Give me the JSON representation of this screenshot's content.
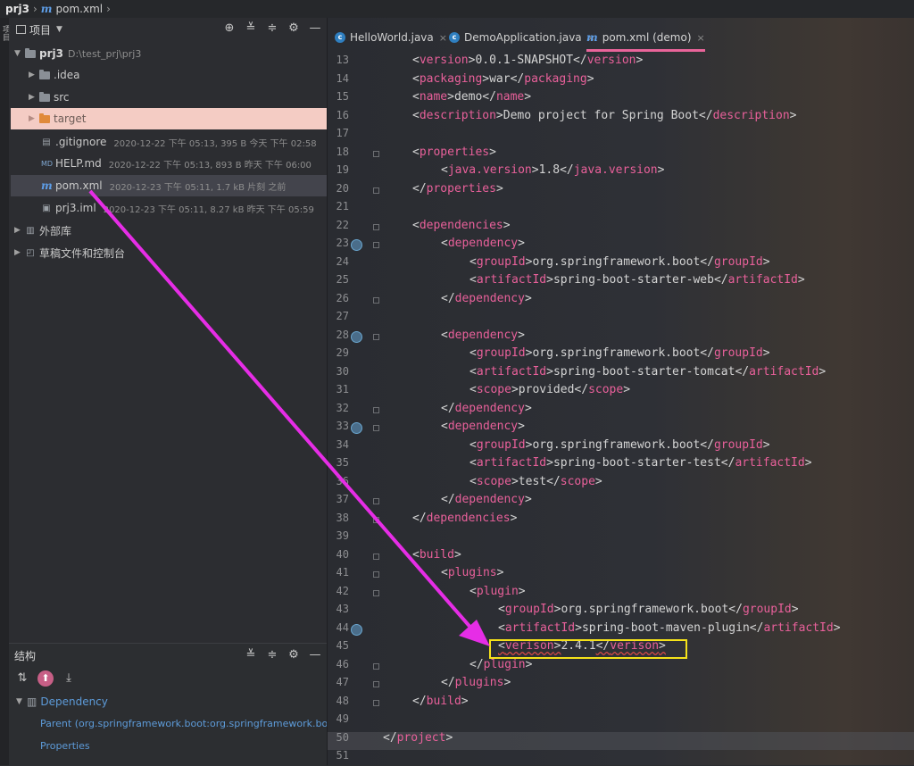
{
  "breadcrumb": {
    "project": "prj3",
    "file": "pom.xml"
  },
  "left_strip": {
    "label": "项目"
  },
  "project_panel": {
    "title": "项目",
    "items": [
      {
        "name": "prj3",
        "path": "D:\\test_prj\\prj3"
      },
      {
        "name": ".idea"
      },
      {
        "name": "src"
      },
      {
        "name": "target"
      },
      {
        "name": ".gitignore",
        "meta": "2020-12-22 下午 05:13, 395 B 今天 下午 02:58"
      },
      {
        "name": "HELP.md",
        "meta": "2020-12-22 下午 05:13, 893 B 昨天 下午 06:00"
      },
      {
        "name": "pom.xml",
        "meta": "2020-12-23 下午 05:11, 1.7 kB 片刻 之前"
      },
      {
        "name": "prj3.iml",
        "meta": "2020-12-23 下午 05:11, 8.27 kB 昨天 下午 05:59"
      },
      {
        "name": "外部库"
      },
      {
        "name": "草稿文件和控制台"
      }
    ]
  },
  "structure_panel": {
    "title": "结构",
    "items": [
      {
        "name": "Dependency"
      },
      {
        "name": "Parent (org.springframework.boot:org.springframework.boot"
      },
      {
        "name": "Properties"
      }
    ]
  },
  "tabs": [
    {
      "label": "HelloWorld.java"
    },
    {
      "label": "DemoApplication.java"
    },
    {
      "label": "pom.xml (demo)"
    }
  ],
  "editor": {
    "lines": [
      {
        "num": "13",
        "indent": 2,
        "open": "version",
        "text": "0.0.1-SNAPSHOT",
        "close": "version"
      },
      {
        "num": "14",
        "indent": 2,
        "open": "packaging",
        "text": "war",
        "close": "packaging"
      },
      {
        "num": "15",
        "indent": 2,
        "open": "name",
        "text": "demo",
        "close": "name"
      },
      {
        "num": "16",
        "indent": 2,
        "open": "description",
        "text": "Demo project for Spring Boot",
        "close": "description"
      },
      {
        "num": "17",
        "indent": 0
      },
      {
        "num": "18",
        "indent": 2,
        "open": "properties",
        "fold": true
      },
      {
        "num": "19",
        "indent": 3,
        "open": "java.version",
        "text": "1.8",
        "close": "java.version"
      },
      {
        "num": "20",
        "indent": 2,
        "close": "properties",
        "fold": true
      },
      {
        "num": "21",
        "indent": 0
      },
      {
        "num": "22",
        "indent": 2,
        "open": "dependencies",
        "fold": true
      },
      {
        "num": "23",
        "indent": 3,
        "open": "dependency",
        "fold": true,
        "gicon": true
      },
      {
        "num": "24",
        "indent": 4,
        "open": "groupId",
        "text": "org.springframework.boot",
        "close": "groupId"
      },
      {
        "num": "25",
        "indent": 4,
        "open": "artifactId",
        "text": "spring-boot-starter-web",
        "close": "artifactId"
      },
      {
        "num": "26",
        "indent": 3,
        "close": "dependency",
        "fold": true
      },
      {
        "num": "27",
        "indent": 0
      },
      {
        "num": "28",
        "indent": 3,
        "open": "dependency",
        "fold": true,
        "gicon": true
      },
      {
        "num": "29",
        "indent": 4,
        "open": "groupId",
        "text": "org.springframework.boot",
        "close": "groupId"
      },
      {
        "num": "30",
        "indent": 4,
        "open": "artifactId",
        "text": "spring-boot-starter-tomcat",
        "close": "artifactId"
      },
      {
        "num": "31",
        "indent": 4,
        "open": "scope",
        "text": "provided",
        "close": "scope"
      },
      {
        "num": "32",
        "indent": 3,
        "close": "dependency",
        "fold": true
      },
      {
        "num": "33",
        "indent": 3,
        "open": "dependency",
        "fold": true,
        "gicon": true
      },
      {
        "num": "34",
        "indent": 4,
        "open": "groupId",
        "text": "org.springframework.boot",
        "close": "groupId"
      },
      {
        "num": "35",
        "indent": 4,
        "open": "artifactId",
        "text": "spring-boot-starter-test",
        "close": "artifactId"
      },
      {
        "num": "36",
        "indent": 4,
        "open": "scope",
        "text": "test",
        "close": "scope"
      },
      {
        "num": "37",
        "indent": 3,
        "close": "dependency",
        "fold": true
      },
      {
        "num": "38",
        "indent": 2,
        "close": "dependencies",
        "fold": true
      },
      {
        "num": "39",
        "indent": 0
      },
      {
        "num": "40",
        "indent": 2,
        "open": "build",
        "fold": true
      },
      {
        "num": "41",
        "indent": 3,
        "open": "plugins",
        "fold": true
      },
      {
        "num": "42",
        "indent": 4,
        "open": "plugin",
        "fold": true
      },
      {
        "num": "43",
        "indent": 5,
        "open": "groupId",
        "text": "org.springframework.boot",
        "close": "groupId"
      },
      {
        "num": "44",
        "indent": 5,
        "open": "artifactId",
        "text": "spring-boot-maven-plugin",
        "close": "artifactId",
        "gicon": true
      },
      {
        "num": "45",
        "indent": 5,
        "open": "verison",
        "text": "2.4.1",
        "close": "verison",
        "error": true
      },
      {
        "num": "46",
        "indent": 4,
        "close": "plugin",
        "fold": true
      },
      {
        "num": "47",
        "indent": 3,
        "close": "plugins",
        "fold": true
      },
      {
        "num": "48",
        "indent": 2,
        "close": "build",
        "fold": true
      },
      {
        "num": "49",
        "indent": 0
      },
      {
        "num": "50",
        "indent": 1,
        "close": "project",
        "current": true
      },
      {
        "num": "51",
        "indent": 0
      }
    ]
  },
  "colors": {
    "tag": "#e8609a",
    "accent": "#e9649a",
    "highlight": "#f5e21a",
    "arrow": "#e62de6"
  }
}
